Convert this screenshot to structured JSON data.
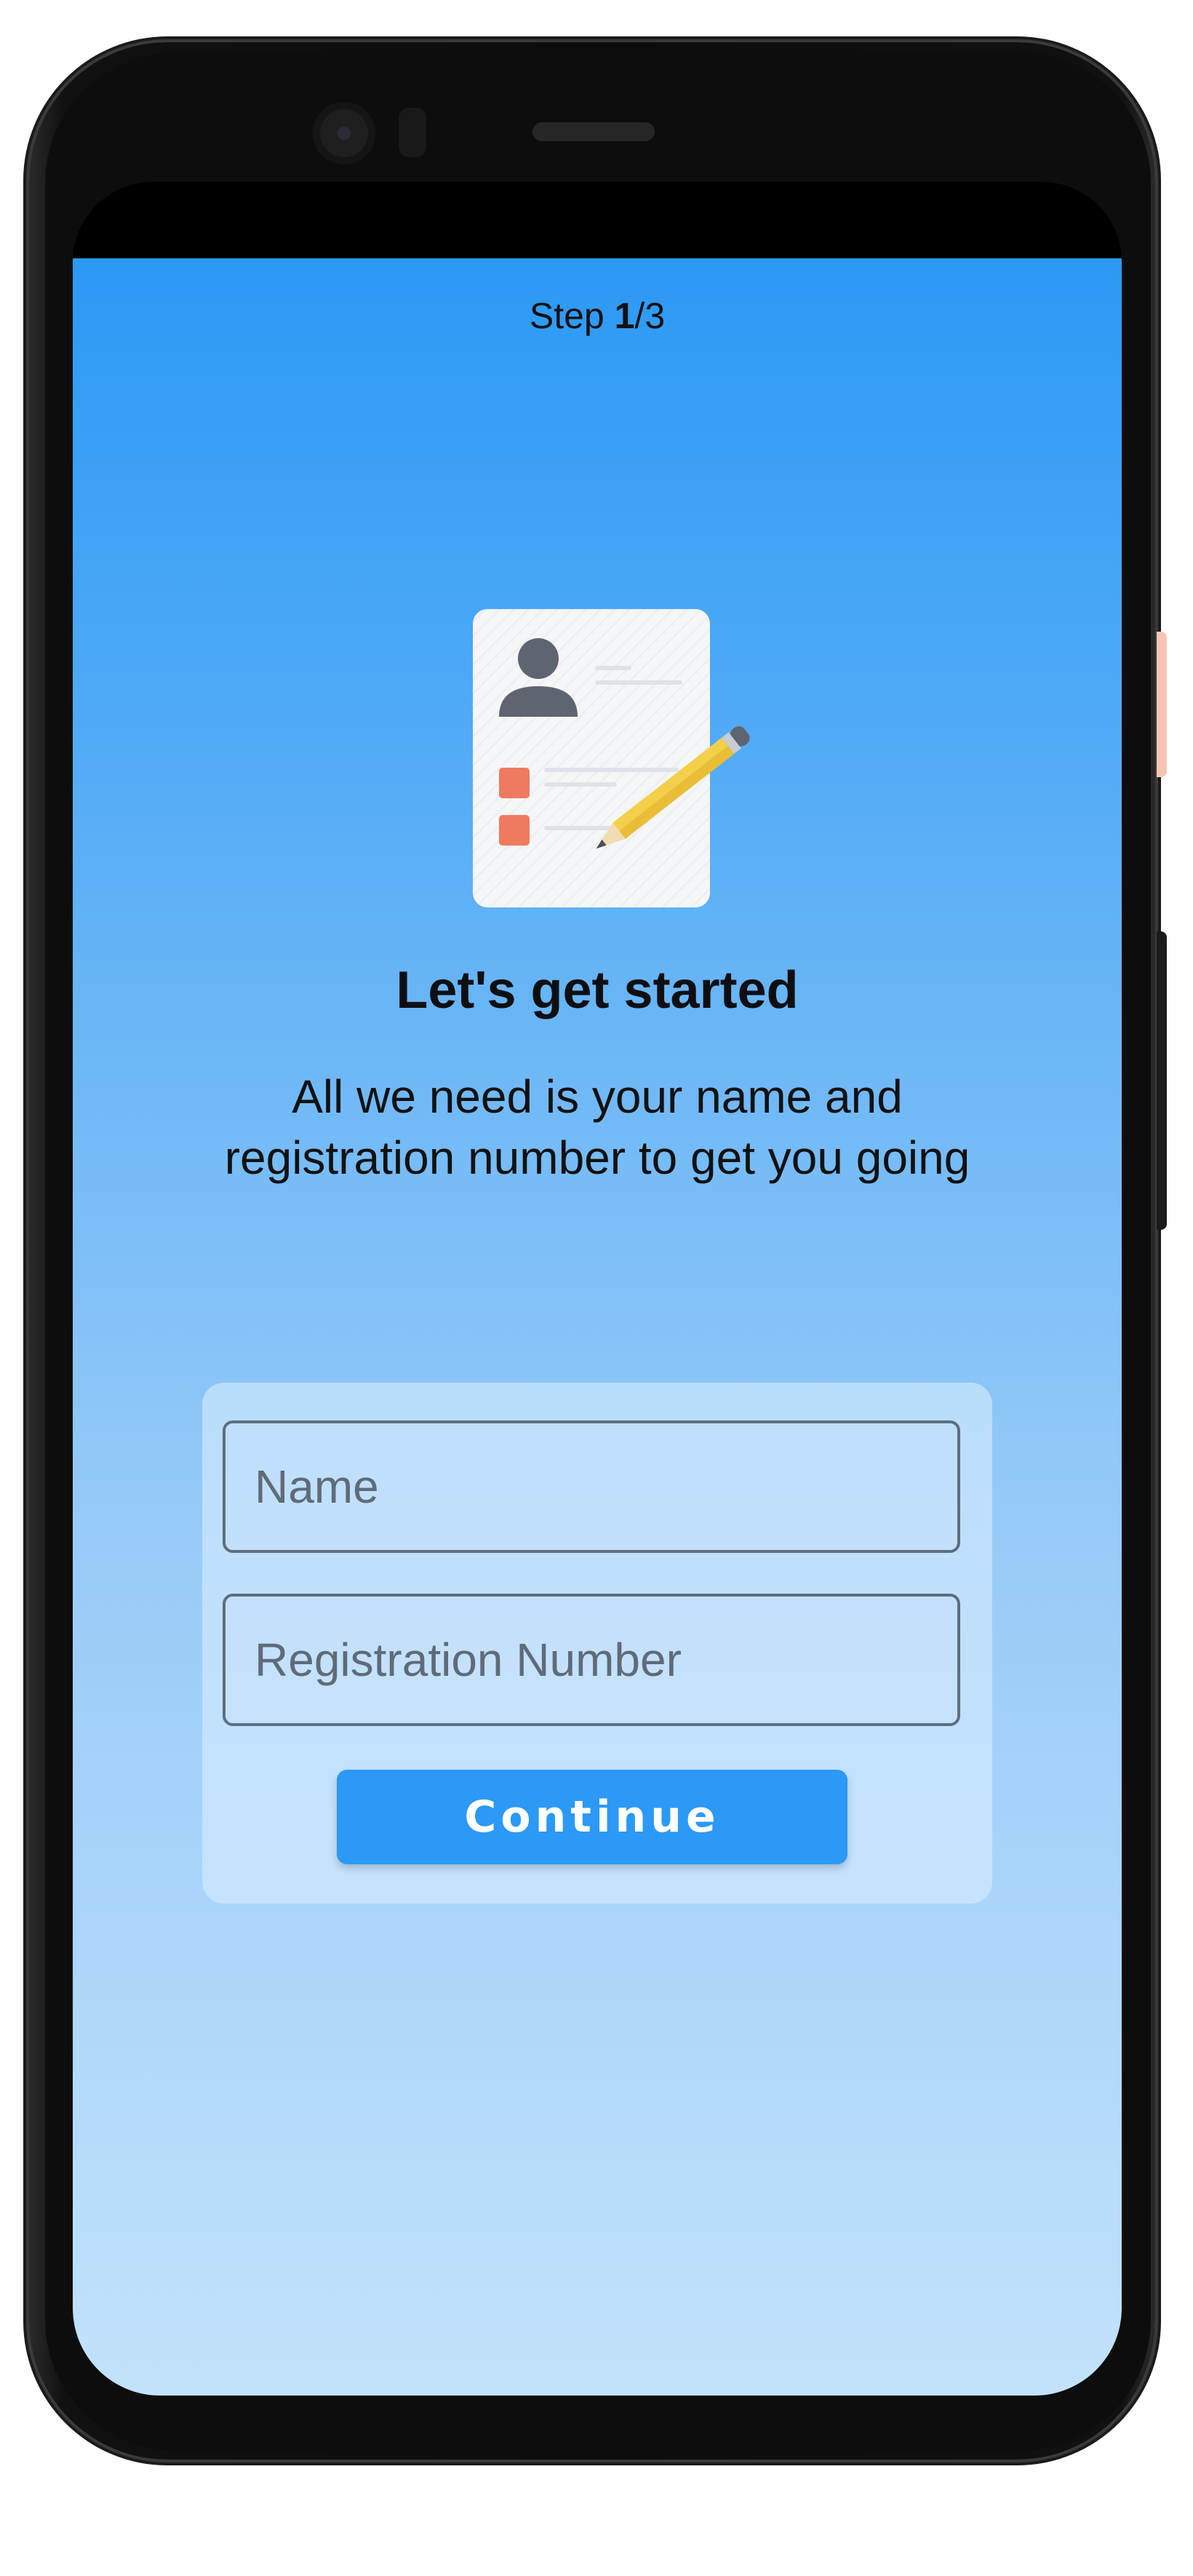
{
  "step": {
    "prefix": "Step ",
    "current": "1",
    "separator": "/",
    "total": "3"
  },
  "onboarding": {
    "headline": "Let's get started",
    "subtitle_line1": "All we need is your name and",
    "subtitle_line2": "registration number to get you going"
  },
  "form": {
    "name_placeholder": "Name",
    "name_value": "",
    "registration_placeholder": "Registration Number",
    "registration_value": "",
    "continue_label": "Continue"
  },
  "icons": {
    "illustration": "profile-form-with-pencil-icon",
    "camera": "front-camera-icon"
  },
  "colors": {
    "accent": "#2b99f5",
    "gradient_top": "#2b99f5",
    "gradient_bottom": "#c3e2fb",
    "checkbox_orange": "#ef7a5f",
    "pencil_yellow": "#f4cf4a"
  }
}
